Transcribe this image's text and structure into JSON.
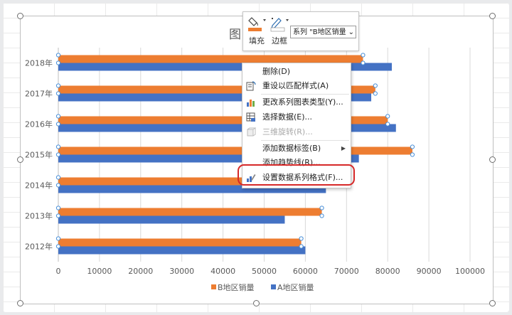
{
  "chart": {
    "title_fragment": "图",
    "legend": {
      "b_label": "B地区销量",
      "a_label": "A地区销量"
    }
  },
  "chart_data": {
    "type": "bar",
    "orientation": "horizontal",
    "categories": [
      "2018年",
      "2017年",
      "2016年",
      "2015年",
      "2014年",
      "2013年",
      "2012年"
    ],
    "series": [
      {
        "name": "B地区销量",
        "color": "#ed7d31",
        "values": [
          74000,
          77000,
          80000,
          86000,
          63000,
          64000,
          59000
        ]
      },
      {
        "name": "A地区销量",
        "color": "#4472c4",
        "values": [
          81000,
          76000,
          82000,
          73000,
          65000,
          55000,
          60000
        ]
      }
    ],
    "xlim": [
      0,
      100000
    ],
    "x_ticks": [
      "0",
      "10000",
      "20000",
      "30000",
      "40000",
      "50000",
      "60000",
      "70000",
      "80000",
      "90000",
      "100000"
    ],
    "grid": true,
    "legend_position": "bottom"
  },
  "minibar": {
    "fill_label": "填充",
    "border_label": "边框",
    "series_select_value": "系列 \"B地区销量",
    "chev": "⌄"
  },
  "context_menu": {
    "items": [
      {
        "label": "删除(D)",
        "icon": "none",
        "enabled": true
      },
      {
        "label": "重设以匹配样式(A)",
        "icon": "reset-style-icon",
        "enabled": true
      },
      {
        "label": "更改系列图表类型(Y)...",
        "icon": "change-chart-type-icon",
        "enabled": true
      },
      {
        "label": "选择数据(E)...",
        "icon": "select-data-icon",
        "enabled": true
      },
      {
        "label": "三维旋转(R)...",
        "icon": "3d-rotation-icon",
        "enabled": false
      },
      {
        "label": "添加数据标签(B)",
        "icon": "none",
        "enabled": true,
        "submenu": "▶"
      },
      {
        "label": "添加趋势线(R)...",
        "icon": "none",
        "enabled": true
      },
      {
        "label": "设置数据系列格式(F)...",
        "icon": "format-series-icon",
        "enabled": true
      }
    ]
  },
  "colors": {
    "series_b": "#ed7d31",
    "series_a": "#4472c4",
    "highlight": "#d62828"
  }
}
